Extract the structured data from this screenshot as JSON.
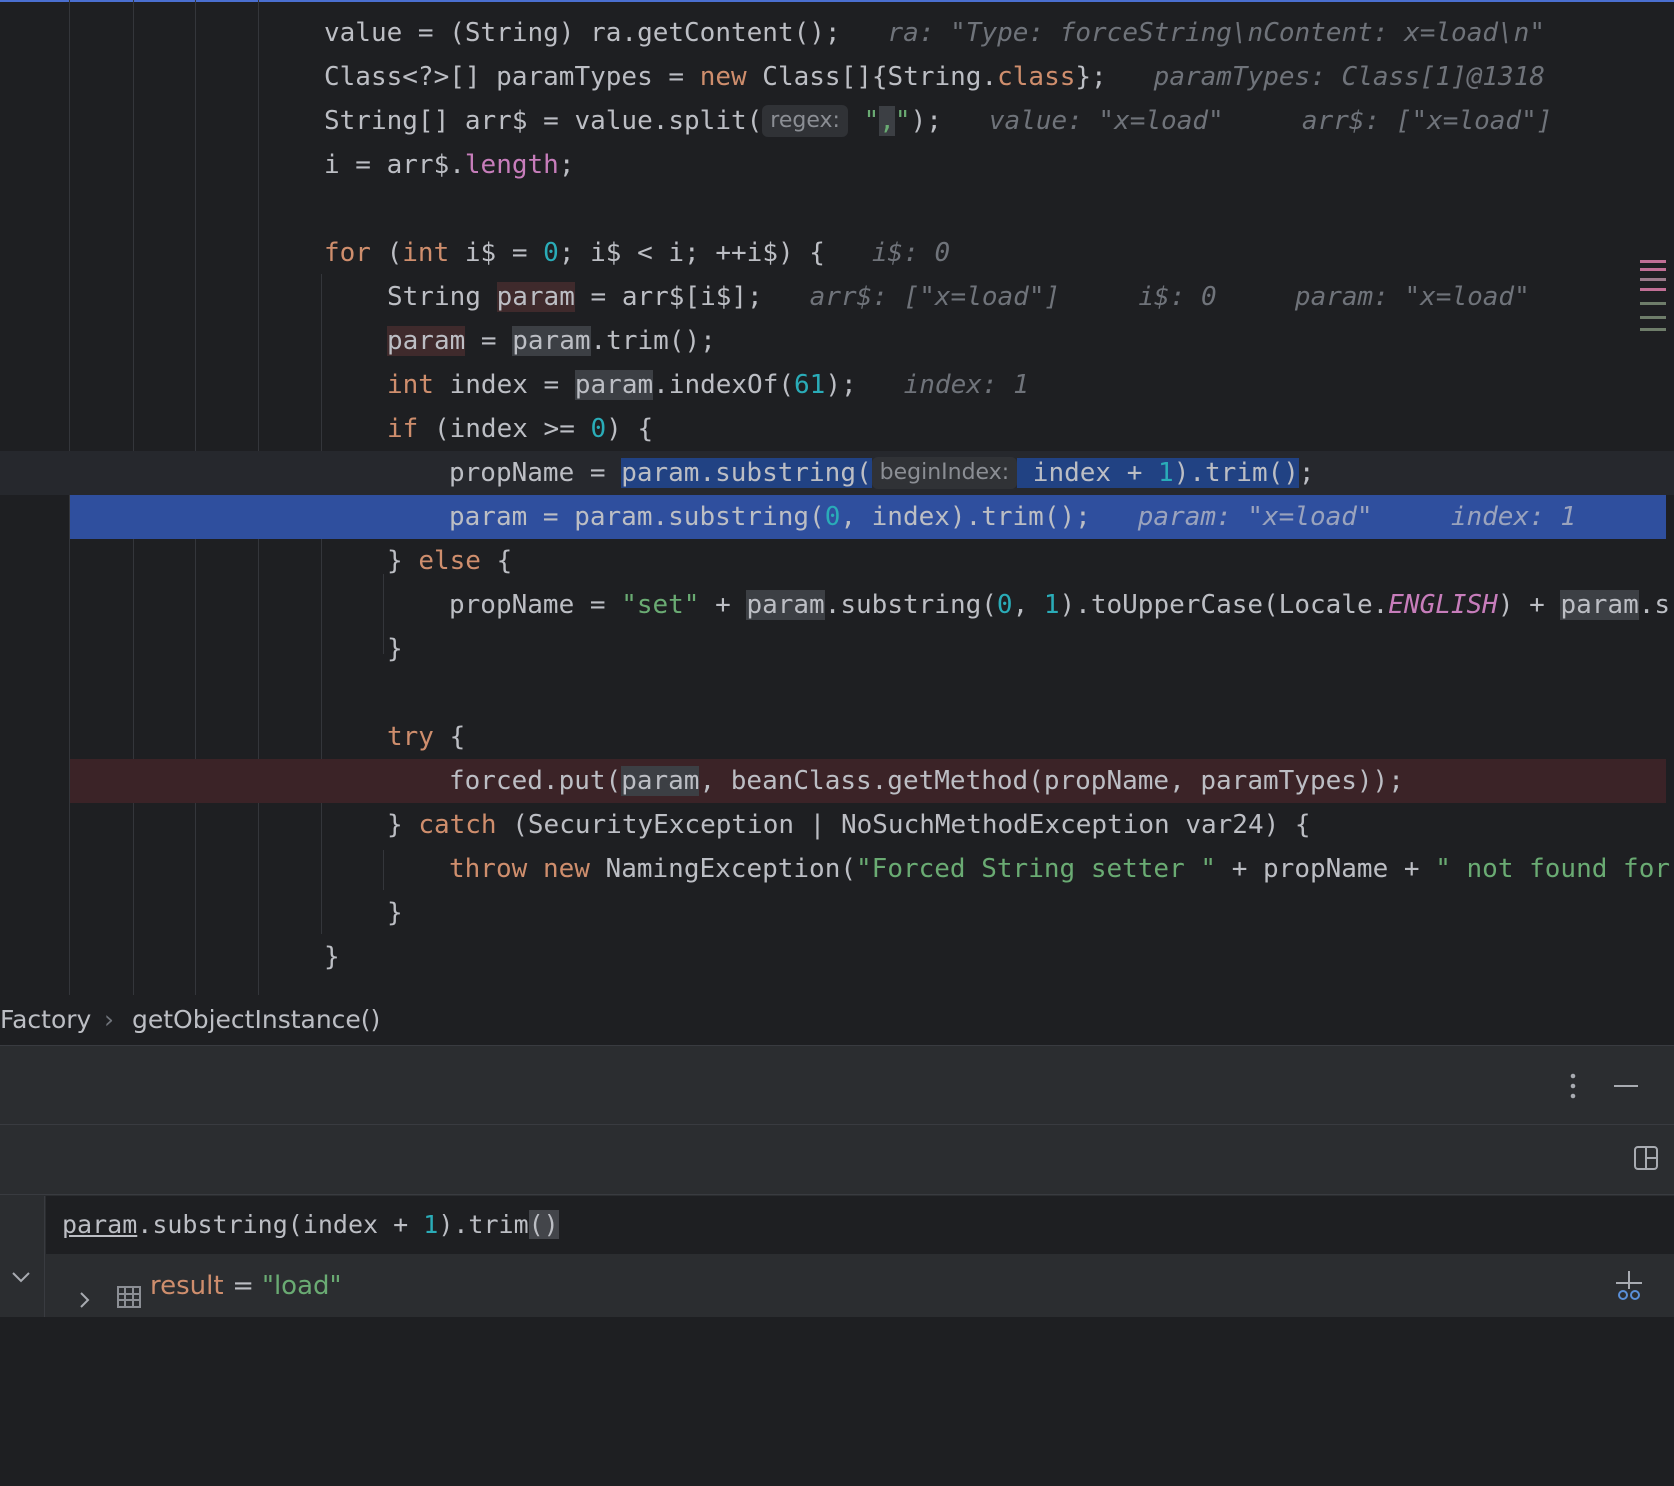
{
  "editor": {
    "lines": [
      {
        "segs": [
          [
            "value = (String) ra.getContent();",
            ""
          ],
          [
            "   ",
            ""
          ],
          [
            "ra: \"Type: forceString\\nContent: x=load\\n\"",
            "dbg"
          ]
        ]
      },
      {
        "segs": [
          [
            "Class<?>[] paramTypes = ",
            ""
          ],
          [
            "new",
            "kw"
          ],
          [
            " Class[]{String.",
            ""
          ],
          [
            "class",
            "kw"
          ],
          [
            "};",
            ""
          ],
          [
            "   ",
            ""
          ],
          [
            "paramTypes: Class[1]@1318",
            "dbg"
          ]
        ]
      },
      {
        "segs": [
          [
            "String[] arr$ = value.split(",
            ""
          ],
          [
            "regex:",
            "hint"
          ],
          [
            " ",
            ""
          ],
          [
            "\"",
            "str"
          ],
          [
            ",",
            "str usage"
          ],
          [
            "\"",
            "str"
          ],
          [
            ");",
            ""
          ],
          [
            "   ",
            ""
          ],
          [
            "value: \"x=load\"     arr$: [\"x=load\"]",
            "dbg"
          ]
        ]
      },
      {
        "segs": [
          [
            "i = arr$.",
            ""
          ],
          [
            "length",
            "field"
          ],
          [
            ";",
            ""
          ]
        ]
      },
      {
        "segs": []
      },
      {
        "segs": [
          [
            "for",
            "kw"
          ],
          [
            " (",
            ""
          ],
          [
            "int",
            "kw"
          ],
          [
            " i$ = ",
            ""
          ],
          [
            "0",
            "num"
          ],
          [
            "; i$ < i; ++i$) {",
            ""
          ],
          [
            "   ",
            ""
          ],
          [
            "i$: 0",
            "dbg"
          ]
        ]
      },
      {
        "segs": [
          [
            "String ",
            ""
          ],
          [
            "param",
            "write"
          ],
          [
            " = arr$[i$];",
            ""
          ],
          [
            "   ",
            ""
          ],
          [
            "arr$: [\"x=load\"]     i$: 0     param: \"x=load\"",
            "dbg"
          ]
        ]
      },
      {
        "segs": [
          [
            "param",
            "write"
          ],
          [
            " = ",
            ""
          ],
          [
            "param",
            "usage"
          ],
          [
            ".trim();",
            ""
          ]
        ]
      },
      {
        "segs": [
          [
            "int",
            "kw"
          ],
          [
            " index = ",
            ""
          ],
          [
            "param",
            "usage"
          ],
          [
            ".indexOf(",
            ""
          ],
          [
            "61",
            "num"
          ],
          [
            ");",
            ""
          ],
          [
            "   ",
            ""
          ],
          [
            "index: 1",
            "dbg"
          ]
        ]
      },
      {
        "segs": [
          [
            "if",
            "kw"
          ],
          [
            " (index >= ",
            ""
          ],
          [
            "0",
            "num"
          ],
          [
            ") {",
            ""
          ]
        ]
      },
      {
        "segs": [
          [
            "propName = ",
            ""
          ],
          [
            "param.substring(",
            "sel"
          ],
          [
            "beginIndex:",
            "hint"
          ],
          [
            " index + ",
            "sel"
          ],
          [
            "1",
            "num sel"
          ],
          [
            ").trim()",
            "sel"
          ],
          [
            ";",
            ""
          ]
        ]
      },
      {
        "segs": [
          [
            "param = param.substring(",
            ""
          ],
          [
            "0",
            "num"
          ],
          [
            ", index).trim();",
            ""
          ],
          [
            "   ",
            ""
          ],
          [
            "param: \"x=load\"     index: 1",
            "dbg"
          ]
        ]
      },
      {
        "segs": [
          [
            "} ",
            ""
          ],
          [
            "else",
            "kw"
          ],
          [
            " {",
            ""
          ]
        ]
      },
      {
        "segs": [
          [
            "propName = ",
            ""
          ],
          [
            "\"set\"",
            "str"
          ],
          [
            " + ",
            ""
          ],
          [
            "param",
            "usage"
          ],
          [
            ".substring(",
            ""
          ],
          [
            "0",
            "num"
          ],
          [
            ", ",
            ""
          ],
          [
            "1",
            "num"
          ],
          [
            ").toUpperCase(Locale.",
            ""
          ],
          [
            "ENGLISH",
            "static"
          ],
          [
            ") + ",
            ""
          ],
          [
            "param",
            "usage"
          ],
          [
            ".s",
            ""
          ]
        ]
      },
      {
        "segs": [
          [
            "}",
            ""
          ]
        ]
      },
      {
        "segs": []
      },
      {
        "segs": [
          [
            "try",
            "kw"
          ],
          [
            " {",
            ""
          ]
        ]
      },
      {
        "segs": [
          [
            "forced.put(",
            ""
          ],
          [
            "param",
            "usage"
          ],
          [
            ", beanClass.getMethod(propName, paramTypes));",
            ""
          ]
        ]
      },
      {
        "segs": [
          [
            "} ",
            ""
          ],
          [
            "catch",
            "kw"
          ],
          [
            " (SecurityException | NoSuchMethodException var24) {",
            ""
          ]
        ]
      },
      {
        "segs": [
          [
            "throw",
            "kw"
          ],
          [
            " ",
            ""
          ],
          [
            "new",
            "kw"
          ],
          [
            " NamingException(",
            ""
          ],
          [
            "\"Forced String setter \"",
            "str"
          ],
          [
            " + propName + ",
            ""
          ],
          [
            "\" not found for",
            "str"
          ]
        ]
      },
      {
        "segs": [
          [
            "}",
            ""
          ]
        ]
      },
      {
        "segs": [
          [
            "}",
            ""
          ]
        ]
      }
    ]
  },
  "breadcrumb": {
    "class_name": "Factory",
    "separator": "›",
    "method": "getObjectInstance()"
  },
  "debug": {
    "more_icon": "more-vertical-icon",
    "minimize_icon": "minimize-icon",
    "layout_icon": "layout-icon",
    "expression": {
      "segs": [
        [
          "param",
          "u"
        ],
        [
          ".substring(index + ",
          ""
        ],
        [
          "1",
          "num"
        ],
        [
          ").trim",
          ""
        ],
        [
          "()",
          "bracket"
        ]
      ]
    },
    "add_watch_icon": "add-watch-icon",
    "history_icon": "chevron-down-icon",
    "result": {
      "expand_icon": "chevron-right-icon",
      "type_icon": "grid-icon",
      "name": "result",
      "equals": " = ",
      "value": "\"load\""
    }
  },
  "colors": {
    "background": "#1e1f22",
    "execution_line": "#2f4f9e",
    "breakpoint_line": "#3b2327",
    "keyword": "#cf8e6d",
    "string": "#6aab73",
    "number": "#2aacb8"
  }
}
